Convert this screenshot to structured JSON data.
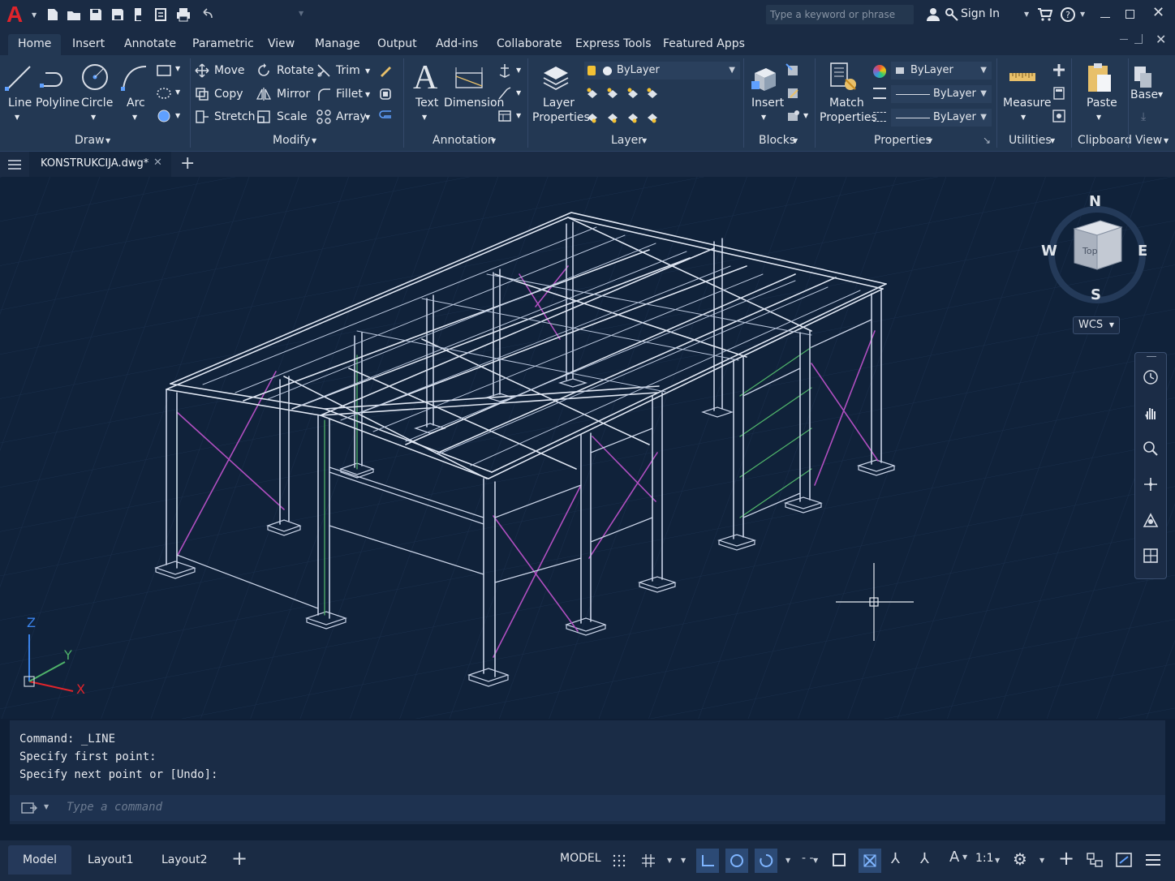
{
  "app": {
    "logo_letter": "A",
    "search_placeholder": "Type a keyword or phrase",
    "sign_in": "Sign In"
  },
  "ribbon_tabs": [
    "Home",
    "Insert",
    "Annotate",
    "Parametric",
    "View",
    "Manage",
    "Output",
    "Add-ins",
    "Collaborate",
    "Express Tools",
    "Featured Apps"
  ],
  "draw": {
    "line": "Line",
    "polyline": "Polyline",
    "circle": "Circle",
    "arc": "Arc",
    "panel": "Draw"
  },
  "modify": {
    "move": "Move",
    "rotate": "Rotate",
    "trim": "Trim",
    "copy": "Copy",
    "mirror": "Mirror",
    "fillet": "Fillet",
    "stretch": "Stretch",
    "scale": "Scale",
    "array": "Array",
    "panel": "Modify"
  },
  "annotation": {
    "text": "Text",
    "dimension": "Dimension",
    "panel": "Annotation"
  },
  "layer": {
    "properties_line1": "Layer",
    "properties_line2": "Properties",
    "current": "ByLayer",
    "panel": "Layer"
  },
  "blocks": {
    "insert": "Insert",
    "panel": "Blocks"
  },
  "properties": {
    "match_line1": "Match",
    "match_line2": "Properties",
    "color": "ByLayer",
    "lineweight": "ByLayer",
    "linetype": "ByLayer",
    "panel": "Properties"
  },
  "utilities": {
    "measure": "Measure",
    "panel": "Utilities"
  },
  "clipboard": {
    "paste": "Paste",
    "panel": "Clipboard"
  },
  "view": {
    "base": "Base",
    "panel": "View"
  },
  "file_tab": "KONSTRUKCIJA.dwg*",
  "viewcube": {
    "n": "N",
    "s": "S",
    "e": "E",
    "w": "W",
    "face": "Top",
    "ucs": "WCS"
  },
  "ucs_axes": {
    "x": "X",
    "y": "Y",
    "z": "Z"
  },
  "command": {
    "lines": [
      "Command: _LINE",
      "Specify first point:",
      "Specify next point or [Undo]:"
    ],
    "placeholder": "Type a command"
  },
  "layouts": [
    "Model",
    "Layout1",
    "Layout2"
  ],
  "status": {
    "model": "MODEL",
    "scale": "1:1"
  },
  "colors": {
    "background": "#10223a",
    "ribbon": "#233853",
    "frame": "#c9d3e6",
    "bracing": "#b04fc0",
    "accent_green": "#4fb36a",
    "accent_red": "#e0242b"
  }
}
